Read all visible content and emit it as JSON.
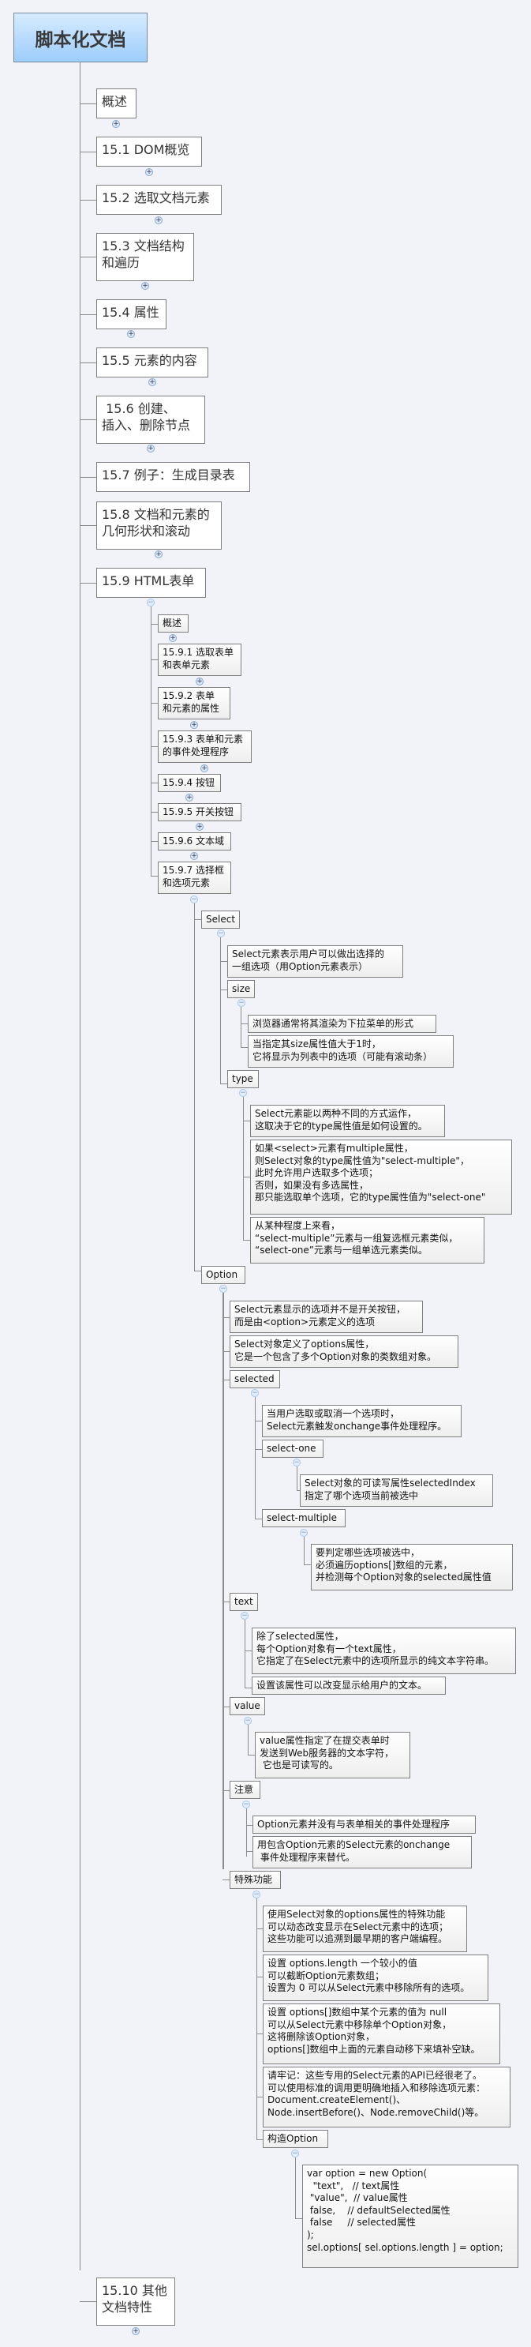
{
  "root": {
    "title": "脚本化文档"
  },
  "toggle_icons": {
    "expand": "+",
    "collapse": "−"
  },
  "chapters": [
    {
      "label": "概述"
    },
    {
      "label": "15.1 DOM概览"
    },
    {
      "label": "15.2 选取文档元素"
    },
    {
      "label": "15.3 文档结构\n和遍历"
    },
    {
      "label": "15.4 属性"
    },
    {
      "label": "15.5 元素的内容"
    },
    {
      "label": " 15.6 创建、\n插入、删除节点"
    },
    {
      "label": "15.7 例子：生成目录表"
    },
    {
      "label": "15.8 文档和元素的\n几何形状和滚动"
    },
    {
      "label": "15.9 HTML表单"
    },
    {
      "label": "15.10 其他\n文档特性"
    }
  ],
  "section_15_9": [
    {
      "label": "概述"
    },
    {
      "label": "15.9.1 选取表单\n和表单元素"
    },
    {
      "label": "15.9.2 表单\n和元素的属性"
    },
    {
      "label": "15.9.3 表单和元素\n的事件处理程序"
    },
    {
      "label": "15.9.4 按钮"
    },
    {
      "label": "15.9.5 开关按钮"
    },
    {
      "label": "15.9.6 文本域"
    },
    {
      "label": "15.9.7 选择框\n和选项元素"
    }
  ],
  "select": {
    "label": "Select",
    "desc": "Select元素表示用户可以做出选择的\n一组选项（用Option元素表示）",
    "size": {
      "label": "size",
      "notes": [
        "浏览器通常将其渲染为下拉菜单的形式",
        "当指定其size属性值大于1时，\n它将显示为列表中的选项（可能有滚动条）"
      ]
    },
    "type": {
      "label": "type",
      "notes": [
        "Select元素能以两种不同的方式运作，\n这取决于它的type属性值是如何设置的。",
        "如果<select>元素有multiple属性，\n则Select对象的type属性值为\"select-multiple\"，\n此时允许用户选取多个选项；\n否则，如果没有多选属性，\n那只能选取单个选项，它的type属性值为\"select-one\"",
        "从某种程度上来看，\n“select-multiple”元素与一组复选框元素类似，\n“select-one”元素与一组单选元素类似。"
      ]
    }
  },
  "option": {
    "label": "Option",
    "notes": [
      "Select元素显示的选项并不是开关按钮，\n而是由<option>元素定义的选项",
      "Select对象定义了options属性，\n它是一个包含了多个Option对象的类数组对象。"
    ],
    "selected": {
      "label": "selected",
      "note": "当用户选取或取消一个选项时，\nSelect元素触发onchange事件处理程序。",
      "select_one": {
        "label": "select-one",
        "note": "Select对象的可读写属性selectedIndex\n指定了哪个选项当前被选中"
      },
      "select_multiple": {
        "label": "select-multiple",
        "note": "要判定哪些选项被选中，\n必须遍历options[]数组的元素，\n并检测每个Option对象的selected属性值"
      }
    },
    "text": {
      "label": "text",
      "notes": [
        "除了selected属性，\n每个Option对象有一个text属性，\n它指定了在Select元素中的选项所显示的纯文本字符串。",
        "设置该属性可以改变显示给用户的文本。"
      ]
    },
    "value": {
      "label": "value",
      "note": "value属性指定了在提交表单时\n发送到Web服务器的文本字符，\n 它也是可读写的。"
    },
    "caution": {
      "label": "注意",
      "notes": [
        "Option元素并没有与表单相关的事件处理程序",
        "用包含Option元素的Select元素的onchange\n 事件处理程序来替代。"
      ]
    },
    "special": {
      "label": "特殊功能",
      "notes": [
        "使用Select对象的options属性的特殊功能\n可以动态改变显示在Select元素中的选项；\n这些功能可以追溯到最早期的客户端编程。",
        "设置 options.length 一个较小的值\n可以截断Option元素数组；\n设置为 0 可以从Select元素中移除所有的选项。",
        "设置 options[]数组中某个元素的值为 null\n可以从Select元素中移除单个Option对象，\n这将删除该Option对象，\noptions[]数组中上面的元素自动移下来填补空缺。",
        "请牢记：这些专用的Select元素的API已经很老了。\n可以使用标准的调用更明确地插入和移除选项元素：\nDocument.createElement()、\nNode.insertBefore()、Node.removeChild()等。"
      ],
      "construct": {
        "label": "构造Option",
        "code": "var option = new Option(\n  \"text\",   // text属性\n \"value\",  // value属性\n false,    // defaultSelected属性\n false     // selected属性\n);\nsel.options[ sel.options.length ] = option;"
      }
    }
  }
}
